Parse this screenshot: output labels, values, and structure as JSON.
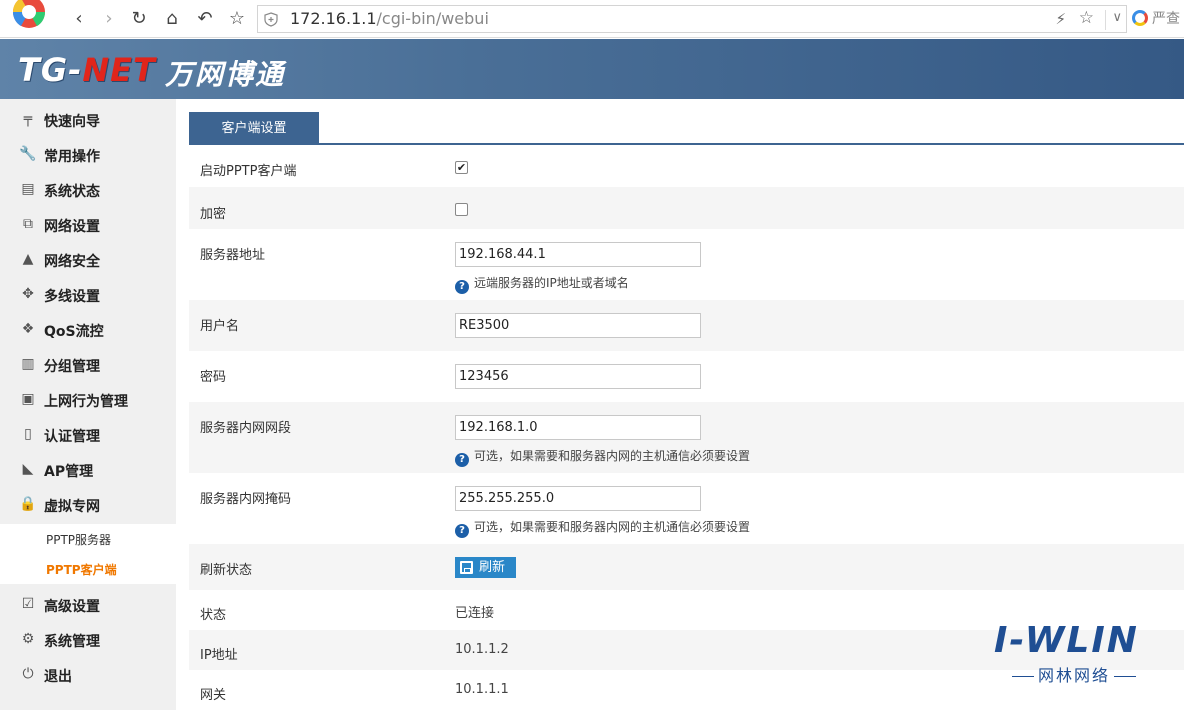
{
  "browser": {
    "url_host": "172.16.1.1",
    "url_path": "/cgi-bin/webui",
    "search_text": "严查"
  },
  "header": {
    "brand_latin_1": "TG-",
    "brand_latin_2": "NET",
    "brand_cn": "万网博通"
  },
  "sidebar": {
    "items": [
      {
        "label": "快速向导",
        "icon": "signpost-icon"
      },
      {
        "label": "常用操作",
        "icon": "wrench-icon"
      },
      {
        "label": "系统状态",
        "icon": "monitor-icon"
      },
      {
        "label": "网络设置",
        "icon": "network-icon"
      },
      {
        "label": "网络安全",
        "icon": "firewall-icon"
      },
      {
        "label": "多线设置",
        "icon": "multiline-icon"
      },
      {
        "label": "QoS流控",
        "icon": "qos-icon"
      },
      {
        "label": "分组管理",
        "icon": "group-icon"
      },
      {
        "label": "上网行为管理",
        "icon": "behavior-icon"
      },
      {
        "label": "认证管理",
        "icon": "auth-icon"
      },
      {
        "label": "AP管理",
        "icon": "ap-icon"
      },
      {
        "label": "虚拟专网",
        "icon": "lock-icon"
      },
      {
        "label": "高级设置",
        "icon": "advanced-icon"
      },
      {
        "label": "系统管理",
        "icon": "gear-icon"
      },
      {
        "label": "退出",
        "icon": "logout-icon"
      }
    ],
    "sub_items": [
      {
        "label": "PPTP服务器",
        "active": false
      },
      {
        "label": "PPTP客户端",
        "active": true
      }
    ]
  },
  "main": {
    "tab_label": "客户端设置",
    "enable_label": "启动PPTP客户端",
    "enable_checked": true,
    "encrypt_label": "加密",
    "encrypt_checked": false,
    "server_addr_label": "服务器地址",
    "server_addr_value": "192.168.44.1",
    "server_addr_hint": "远端服务器的IP地址或者域名",
    "username_label": "用户名",
    "username_value": "RE3500",
    "password_label": "密码",
    "password_value": "123456",
    "lan_segment_label": "服务器内网网段",
    "lan_segment_value": "192.168.1.0",
    "lan_segment_hint": "可选，如果需要和服务器内网的主机通信必须要设置",
    "lan_mask_label": "服务器内网掩码",
    "lan_mask_value": "255.255.255.0",
    "lan_mask_hint": "可选，如果需要和服务器内网的主机通信必须要设置",
    "refresh_label": "刷新状态",
    "refresh_button": "刷新",
    "status_label": "状态",
    "status_value": "已连接",
    "ip_label": "IP地址",
    "ip_value": "10.1.1.2",
    "gateway_label": "网关",
    "gateway_value": "10.1.1.1"
  },
  "watermark": {
    "logo_text": "I-WLIN",
    "logo_sub": "网林网络"
  }
}
